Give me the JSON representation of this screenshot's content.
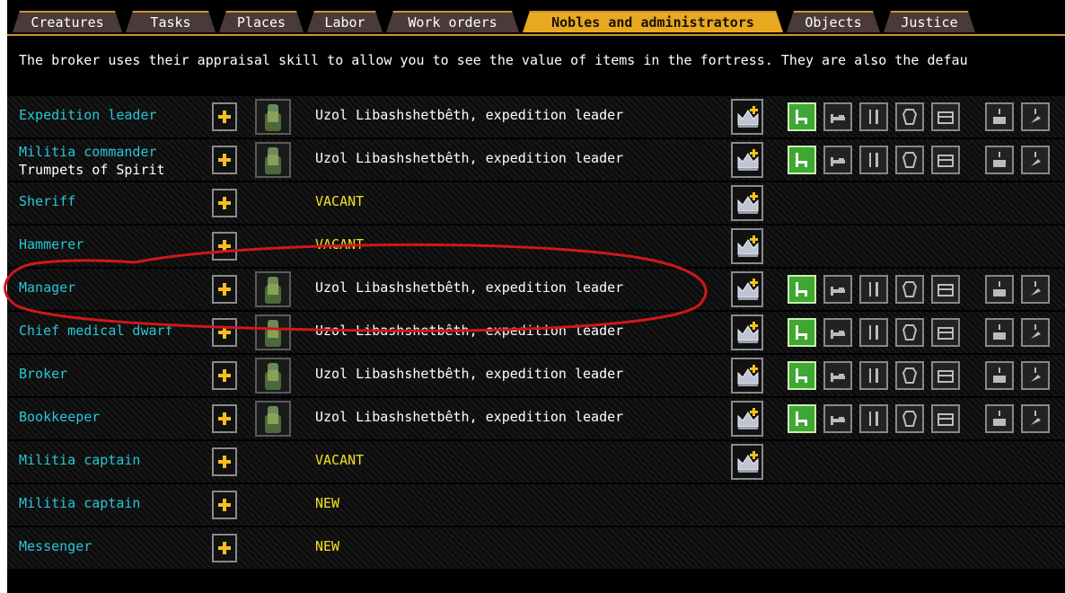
{
  "tabs": [
    {
      "label": "Creatures"
    },
    {
      "label": "Tasks"
    },
    {
      "label": "Places"
    },
    {
      "label": "Labor"
    },
    {
      "label": "Work orders"
    },
    {
      "label": "Nobles and administrators",
      "active": true
    },
    {
      "label": "Objects"
    },
    {
      "label": "Justice"
    }
  ],
  "description": "The broker uses their appraisal skill to allow you to see the value of items in the fortress. They are also the defau",
  "rows": [
    {
      "position": "Expedition leader",
      "assignee": "Uzol Libashshetbêth, expedition leader"
    },
    {
      "position": "Militia commander",
      "subtitle": "Trumpets of Spirit",
      "assignee": "Uzol Libashshetbêth, expedition leader"
    },
    {
      "position": "Sheriff",
      "assignee": "VACANT"
    },
    {
      "position": "Hammerer",
      "assignee": "VACANT"
    },
    {
      "position": "Manager",
      "assignee": "Uzol Libashshetbêth, expedition leader"
    },
    {
      "position": "Chief medical dwarf",
      "assignee": "Uzol Libashshetbêth, expedition leader"
    },
    {
      "position": "Broker",
      "assignee": "Uzol Libashshetbêth, expedition leader"
    },
    {
      "position": "Bookkeeper",
      "assignee": "Uzol Libashshetbêth, expedition leader"
    },
    {
      "position": "Militia captain",
      "assignee": "VACANT"
    },
    {
      "position": "Militia captain",
      "assignee": "NEW"
    },
    {
      "position": "Messenger",
      "assignee": "NEW"
    }
  ],
  "colors": {
    "position_text": "#27c7d6",
    "vacant_text": "#f4e020",
    "active_tab": "#e8a820",
    "annotation": "#d01818",
    "satisfied_requirement": "#3fa832"
  },
  "icons": {
    "add": "plus-icon",
    "portrait": "dwarf-portrait-icon",
    "position_settings": "crown-plus-icon",
    "requirements": [
      "chair-icon",
      "bed-icon",
      "dining-utensils-icon",
      "tomb-icon",
      "chest-icon",
      "box-alert-icon",
      "hammer-alert-icon"
    ]
  }
}
